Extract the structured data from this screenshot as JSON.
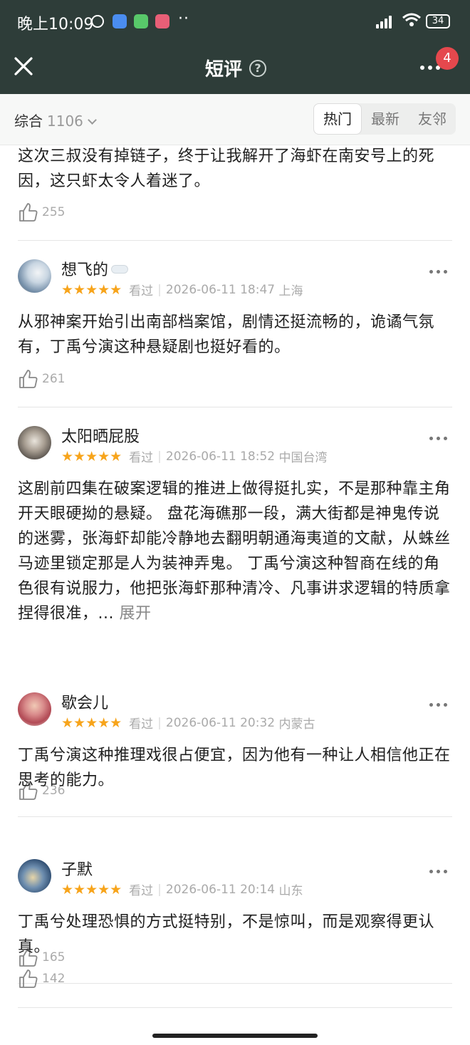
{
  "status_bar": {
    "time": "晚上10:09",
    "more": "··",
    "battery": "34"
  },
  "header": {
    "title": "短评",
    "help": "?",
    "badge_count": "4"
  },
  "filter": {
    "sort_label": "综合",
    "total_count": "1106",
    "tabs": [
      {
        "label": "热门",
        "active": true
      },
      {
        "label": "最新",
        "active": false
      },
      {
        "label": "友邻",
        "active": false
      }
    ]
  },
  "top_partial": {
    "text": "这次三叔没有掉链子，终于让我解开了海虾在南安号上的死因，这只虾太令人着迷了。",
    "likes": "255"
  },
  "reviews": [
    {
      "username": "想飞的",
      "stars": "★★★★★",
      "status": "看过",
      "datetime": "2026-06-11 18:47",
      "location": "上海",
      "text": "从邪神案开始引出南部档案馆，剧情还挺流畅的，诡谲气氛有，丁禹兮演这种悬疑剧也挺好看的。",
      "likes": "261",
      "rating": 5
    },
    {
      "username": "太阳晒屁股",
      "stars": "★★★★★",
      "status": "看过",
      "datetime": "2026-06-11 18:52",
      "location": "中国台湾",
      "text": "这剧前四集在破案逻辑的推进上做得挺扎实，不是那种靠主角开天眼硬拗的悬疑。 盘花海礁那一段，满大街都是神鬼传说的迷雾，张海虾却能冷静地去翻明朝通海夷道的文献，从蛛丝马迹里锁定那是人为装神弄鬼。 丁禹兮演这种智商在线的角色很有说服力，他把张海虾那种清冷、凡事讲求逻辑的特质拿捏得很准，... ",
      "expand": "展开",
      "likes": "236",
      "rating": 5
    },
    {
      "username": "歇会儿",
      "stars": "★★★★★",
      "status": "看过",
      "datetime": "2026-06-11 20:32",
      "location": "内蒙古",
      "text": "丁禹兮演这种推理戏很占便宜，因为他有一种让人相信他正在思考的能力。",
      "likes": "165",
      "rating": 5
    },
    {
      "username": "子默",
      "stars": "★★★★★",
      "status": "看过",
      "datetime": "2026-06-11 20:14",
      "location": "山东",
      "text": "丁禹兮处理恐惧的方式挺特别，不是惊叫，而是观察得更认真。",
      "likes": "142",
      "rating": 5
    }
  ],
  "colors": {
    "header_bg": "#2e3d39",
    "star": "#f7a41b",
    "badge": "#e5484d"
  }
}
